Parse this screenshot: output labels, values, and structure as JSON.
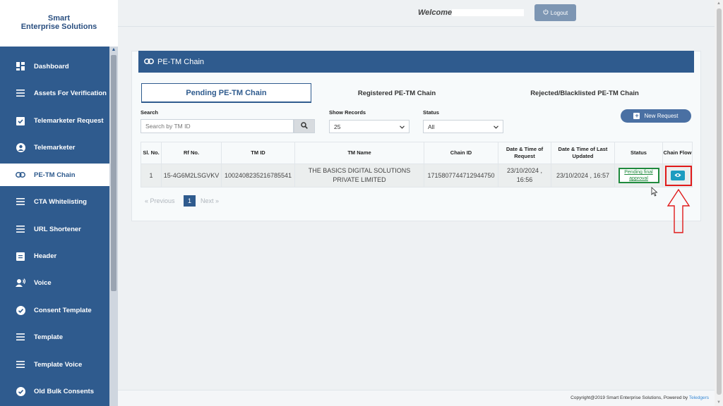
{
  "brand": {
    "line1": "Smart",
    "line2": "Enterprise Solutions"
  },
  "sidebar": {
    "items": [
      {
        "label": "Dashboard",
        "icon": "grid-icon"
      },
      {
        "label": "Assets For Verification",
        "icon": "list-icon"
      },
      {
        "label": "Telemarketer Request",
        "icon": "clipboard-check-icon"
      },
      {
        "label": "Telemarketer",
        "icon": "user-circle-icon"
      },
      {
        "label": "PE-TM Chain",
        "icon": "link-icon",
        "active": true
      },
      {
        "label": "CTA Whitelisting",
        "icon": "list-icon"
      },
      {
        "label": "URL Shortener",
        "icon": "list-icon"
      },
      {
        "label": "Header",
        "icon": "clipboard-icon"
      },
      {
        "label": "Voice",
        "icon": "voice-user-icon"
      },
      {
        "label": "Consent Template",
        "icon": "check-circle-icon"
      },
      {
        "label": "Template",
        "icon": "list-icon"
      },
      {
        "label": "Template Voice",
        "icon": "list-icon"
      },
      {
        "label": "Old Bulk Consents",
        "icon": "check-circle-icon"
      }
    ]
  },
  "header": {
    "welcome": "Welcome,",
    "logout_label": "Logout"
  },
  "panel": {
    "title": "PE-TM Chain"
  },
  "tabs": [
    {
      "label": "Pending PE-TM Chain",
      "active": true
    },
    {
      "label": "Registered PE-TM Chain"
    },
    {
      "label": "Rejected/Blacklisted PE-TM Chain"
    }
  ],
  "filters": {
    "search_label": "Search",
    "search_placeholder": "Search by TM ID",
    "show_records_label": "Show Records",
    "show_records_value": "25",
    "status_label": "Status",
    "status_value": "All",
    "new_request_label": "New Request"
  },
  "table": {
    "headers": {
      "sl_no": "Sl. No.",
      "rf_no": "Rf No.",
      "tm_id": "TM ID",
      "tm_name": "TM Name",
      "chain_id": "Chain ID",
      "request_time": "Date & Time of Request",
      "updated_time": "Date & Time of Last Updated",
      "status": "Status",
      "chain_flow": "Chain Flow"
    },
    "rows": [
      {
        "sl_no": "1",
        "rf_no": "15-4G6M2LSGVKV",
        "tm_id": "1002408235216785541",
        "tm_name": "THE BASICS DIGITAL SOLUTIONS PRIVATE LIMITED",
        "chain_id": "1715807744712944750",
        "request_time": "23/10/2024 , 16:56",
        "updated_time": "23/10/2024 , 16:57",
        "status": "Pending final approval"
      }
    ]
  },
  "pagination": {
    "previous": "Previous",
    "current": "1",
    "next": "Next"
  },
  "footer": {
    "text": "Copyright@2019 Smart Enterprise Solutions, Powered by",
    "link": "Teledgers"
  },
  "colors": {
    "primary": "#2f5b8e",
    "status_green": "#1f8a3d",
    "eye_button": "#1c9cc0",
    "highlight": "#e01a1a"
  }
}
